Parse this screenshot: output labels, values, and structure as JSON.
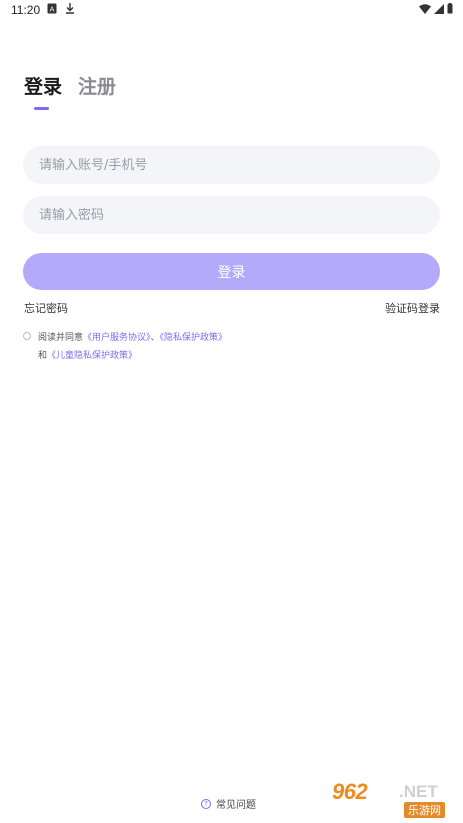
{
  "status_bar": {
    "time": "11:20",
    "left_icons": [
      "a-box-icon",
      "download-icon"
    ],
    "right_icons": [
      "wifi-icon",
      "signal-icon",
      "battery-icon"
    ]
  },
  "tabs": [
    {
      "label": "登录",
      "active": true
    },
    {
      "label": "注册",
      "active": false
    }
  ],
  "form": {
    "account_placeholder": "请输入账号/手机号",
    "password_placeholder": "请输入密码",
    "login_button": "登录",
    "forgot_password": "忘记密码",
    "code_login": "验证码登录"
  },
  "agreement": {
    "prefix": "阅读并同意",
    "user_agreement": "《用户服务协议》",
    "separator": "、",
    "privacy_policy": "《隐私保护政策》",
    "and": "和",
    "child_privacy": "《儿童隐私保护政策》"
  },
  "faq": {
    "icon": "?",
    "label": "常见问题"
  },
  "watermark": {
    "big": "962",
    "net": ".NET",
    "small": "乐游网"
  },
  "colors": {
    "accent": "#7b6cf6",
    "button_bg": "#b3aafa",
    "input_bg": "#f4f5f9"
  }
}
